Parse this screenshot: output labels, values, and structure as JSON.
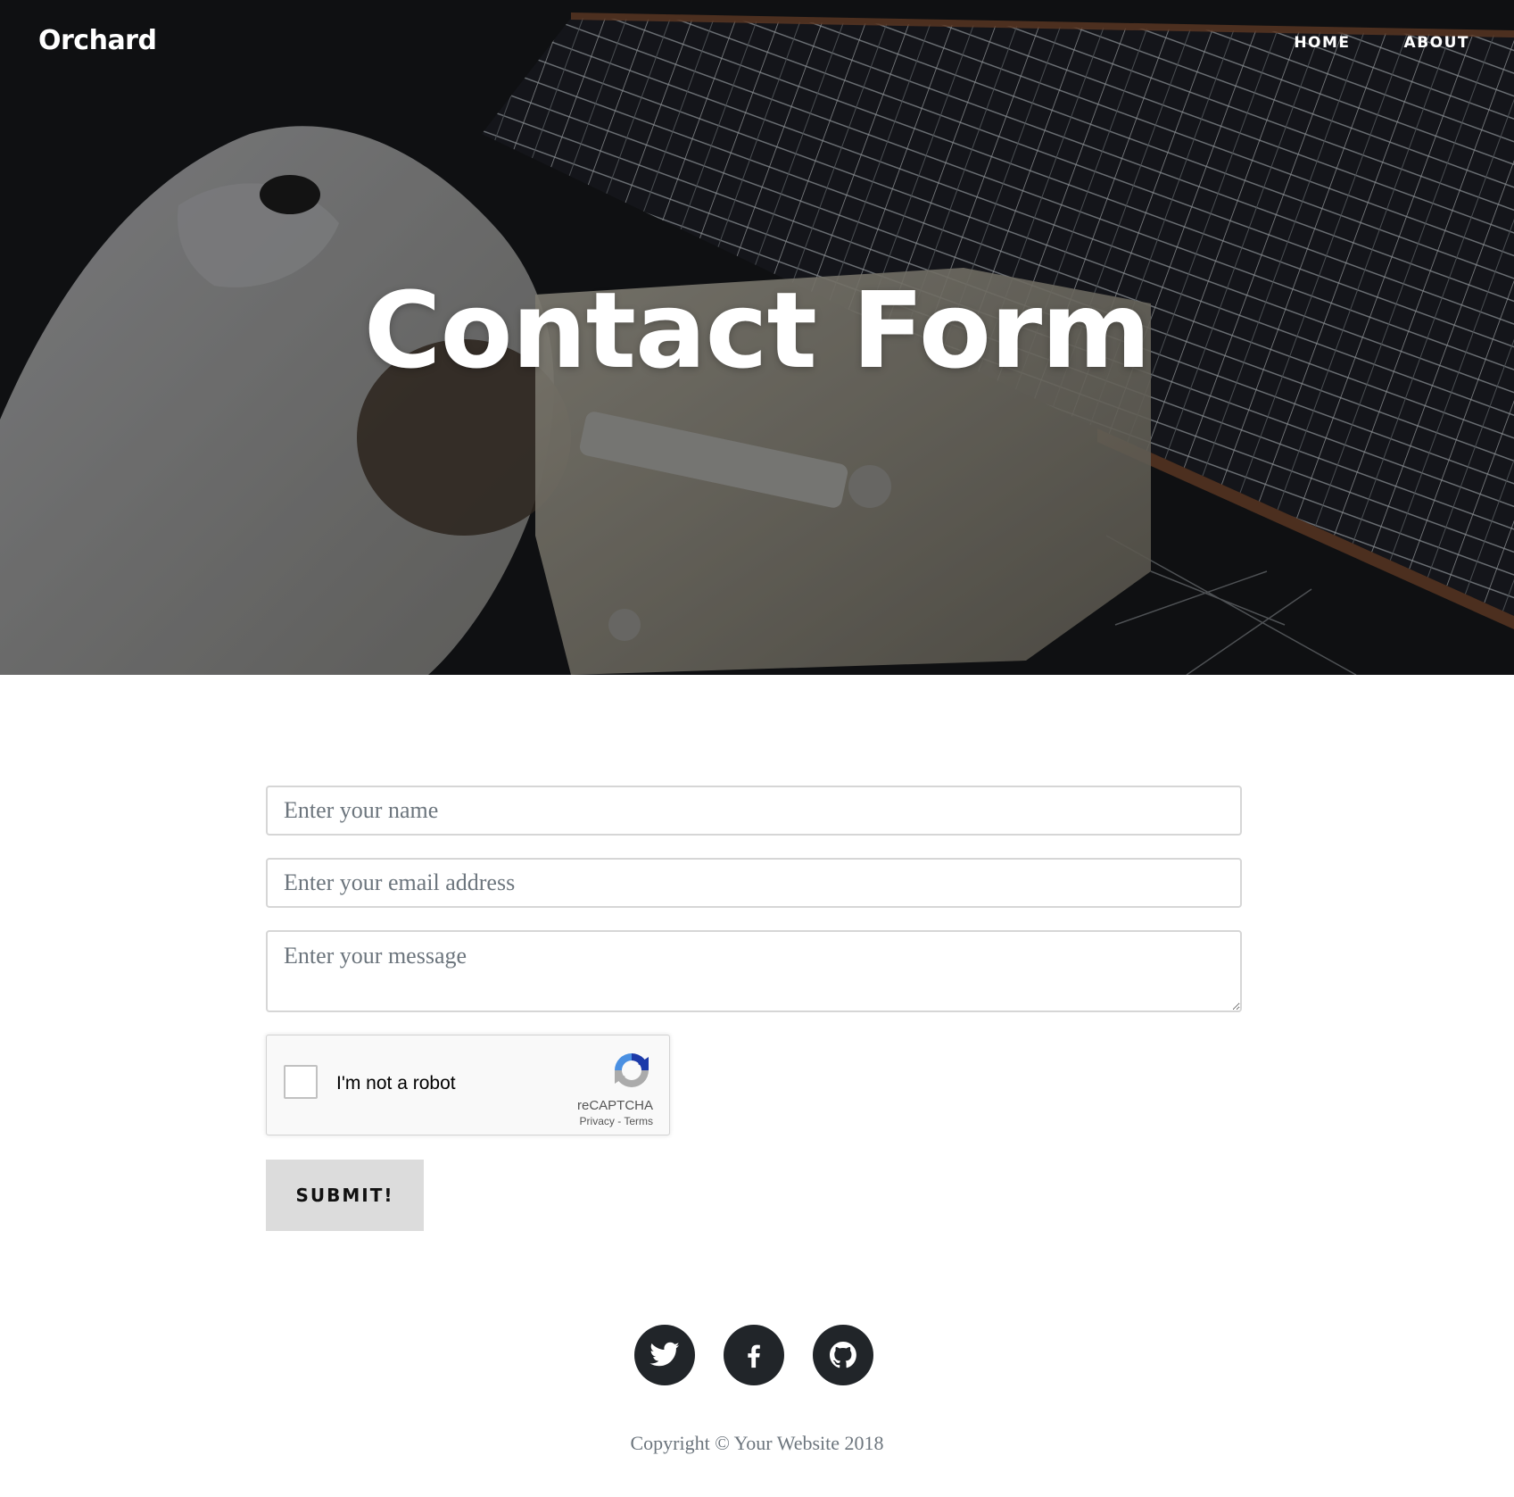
{
  "header": {
    "brand": "Orchard",
    "nav": [
      {
        "label": "HOME"
      },
      {
        "label": "ABOUT"
      }
    ]
  },
  "hero": {
    "title": "Contact Form"
  },
  "form": {
    "name_placeholder": "Enter your name",
    "email_placeholder": "Enter your email address",
    "message_placeholder": "Enter your message",
    "captcha": {
      "label": "I'm not a robot",
      "brand": "reCAPTCHA",
      "privacy": "Privacy",
      "separator": " - ",
      "terms": "Terms"
    },
    "submit_label": "SUBMIT!"
  },
  "footer": {
    "social": [
      {
        "icon": "twitter-icon"
      },
      {
        "icon": "facebook-icon"
      },
      {
        "icon": "github-icon"
      }
    ],
    "copyright": "Copyright © Your Website 2018"
  },
  "colors": {
    "hero_overlay": "#141619",
    "social_circle": "#212529",
    "submit_bg": "#dcdcdc",
    "muted_text": "#6c757d"
  }
}
